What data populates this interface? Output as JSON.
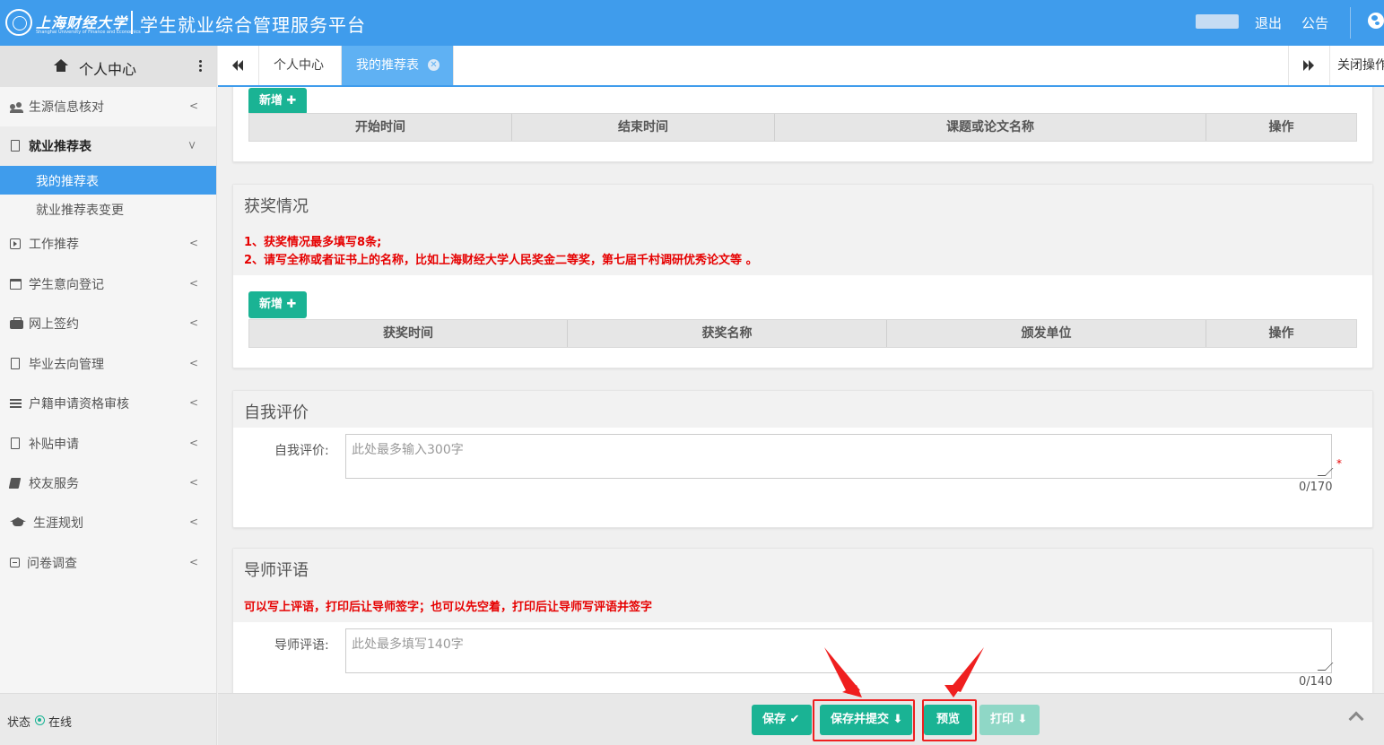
{
  "header": {
    "logo_script": "上海财经大学",
    "logo_sub": "Shanghai University of Finance and Economics",
    "title": "学生就业综合管理服务平台",
    "logout": "退出",
    "notice": "公告",
    "brand_color": "#3f9cec"
  },
  "sidebar": {
    "title": "个人中心",
    "items": [
      {
        "label": "生源信息核对",
        "icon": "users-icon"
      },
      {
        "label": "就业推荐表",
        "icon": "doc-icon",
        "expanded": true
      },
      {
        "label": "工作推荐",
        "icon": "play-square-icon"
      },
      {
        "label": "学生意向登记",
        "icon": "calendar-icon"
      },
      {
        "label": "网上签约",
        "icon": "briefcase-icon"
      },
      {
        "label": "毕业去向管理",
        "icon": "doc-icon"
      },
      {
        "label": "户籍申请资格审核",
        "icon": "bars-icon"
      },
      {
        "label": "补贴申请",
        "icon": "doc-icon"
      },
      {
        "label": "校友服务",
        "icon": "book-icon"
      },
      {
        "label": "生涯规划",
        "icon": "graduation-cap-icon"
      },
      {
        "label": "问卷调查",
        "icon": "minus-square-icon"
      }
    ],
    "sub_items": [
      {
        "label": "我的推荐表",
        "active": true
      },
      {
        "label": "就业推荐表变更"
      }
    ],
    "status_label": "状态",
    "status_value": "在线"
  },
  "tabs": {
    "home": "个人中心",
    "active": "我的推荐表",
    "close_ops": "关闭操作"
  },
  "research": {
    "add_label": "新增",
    "columns": [
      "开始时间",
      "结束时间",
      "课题或论文名称",
      "操作"
    ]
  },
  "awards": {
    "title": "获奖情况",
    "note1": "1、获奖情况最多填写8条;",
    "note2": "2、请写全称或者证书上的名称，比如上海财经大学人民奖金二等奖，第七届千村调研优秀论文等 。",
    "add_label": "新增",
    "columns": [
      "获奖时间",
      "获奖名称",
      "颁发单位",
      "操作"
    ]
  },
  "self_eval": {
    "title": "自我评价",
    "label": "自我评价:",
    "placeholder": "此处最多输入300字",
    "counter": "0/170",
    "required_mark": "*"
  },
  "mentor": {
    "title": "导师评语",
    "note": "可以写上评语，打印后让导师签字；也可以先空着，打印后让导师写评语并签字",
    "label": "导师评语:",
    "placeholder": "此处最多填写140字",
    "counter": "0/140"
  },
  "actions": {
    "save": "保存",
    "save_submit": "保存并提交",
    "preview": "预览",
    "print": "打印"
  }
}
